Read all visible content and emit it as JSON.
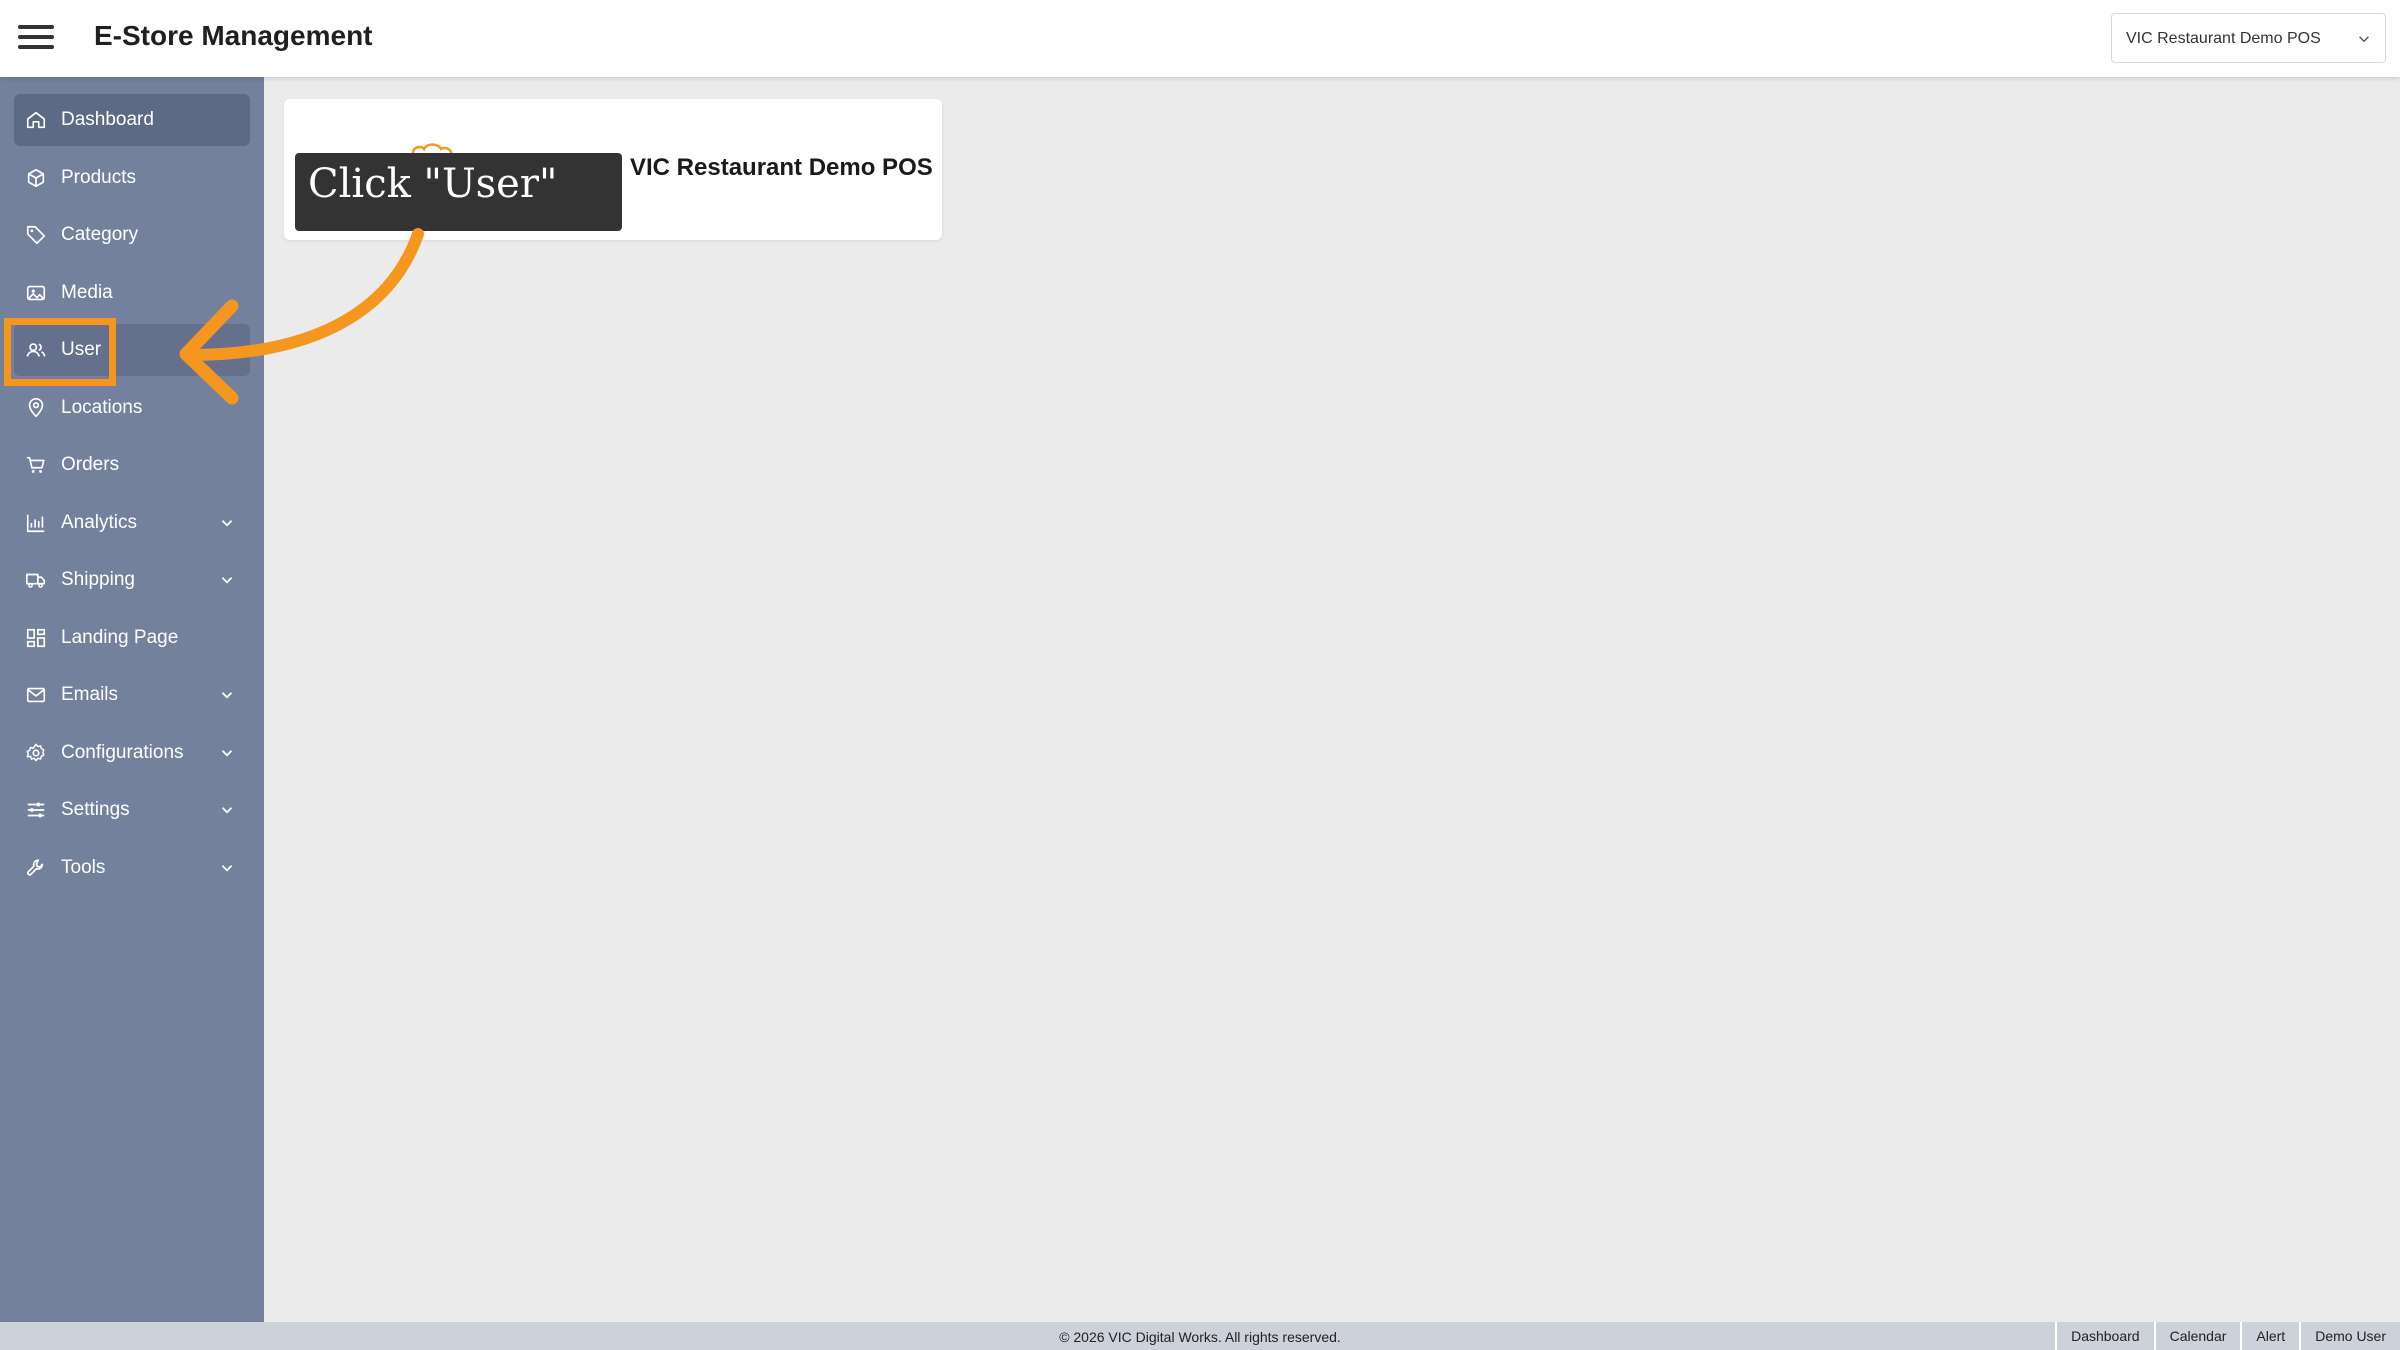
{
  "header": {
    "title": "E-Store Management",
    "store_selector": {
      "value": "VIC Restaurant Demo POS"
    }
  },
  "sidebar": {
    "items": [
      {
        "label": "Dashboard",
        "icon": "home-icon",
        "expandable": false,
        "active": true
      },
      {
        "label": "Products",
        "icon": "box-icon",
        "expandable": false
      },
      {
        "label": "Category",
        "icon": "tag-icon",
        "expandable": false
      },
      {
        "label": "Media",
        "icon": "image-icon",
        "expandable": false
      },
      {
        "label": "User",
        "icon": "users-icon",
        "expandable": false,
        "hover": true
      },
      {
        "label": "Locations",
        "icon": "map-pin-icon",
        "expandable": false
      },
      {
        "label": "Orders",
        "icon": "cart-icon",
        "expandable": false
      },
      {
        "label": "Analytics",
        "icon": "bar-chart-icon",
        "expandable": true
      },
      {
        "label": "Shipping",
        "icon": "truck-icon",
        "expandable": true
      },
      {
        "label": "Landing Page",
        "icon": "grid-icon",
        "expandable": false
      },
      {
        "label": "Emails",
        "icon": "mail-icon",
        "expandable": true
      },
      {
        "label": "Configurations",
        "icon": "gear-icon",
        "expandable": true
      },
      {
        "label": "Settings",
        "icon": "sliders-icon",
        "expandable": true
      },
      {
        "label": "Tools",
        "icon": "wrench-icon",
        "expandable": true
      }
    ]
  },
  "main": {
    "store_card": {
      "name": "VIC Restaurant Demo POS"
    }
  },
  "annotation": {
    "text": "Click \"User\"",
    "color": "#f5961e"
  },
  "footer": {
    "copyright": "© 2026 VIC Digital Works. All rights reserved.",
    "links": [
      "Dashboard",
      "Calendar",
      "Alert",
      "Demo User"
    ]
  },
  "colors": {
    "sidebar_bg": "#74819c",
    "sidebar_active": "#5d6a85",
    "accent": "#f5961e",
    "footer_bg": "#cdd1da"
  }
}
